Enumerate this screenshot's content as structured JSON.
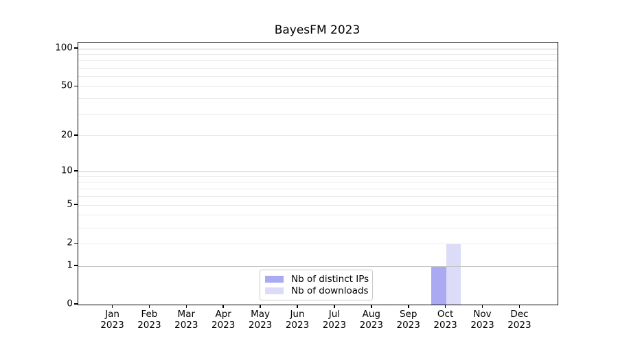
{
  "figure": {
    "title": "BayesFM 2023"
  },
  "chart_data": {
    "type": "bar",
    "title": "BayesFM 2023",
    "categories": [
      "Jan",
      "Feb",
      "Mar",
      "Apr",
      "May",
      "Jun",
      "Jul",
      "Aug",
      "Sep",
      "Oct",
      "Nov",
      "Dec"
    ],
    "year": "2023",
    "series": [
      {
        "name": "Nb of distinct IPs",
        "color": "#aaaaf2",
        "values": [
          0,
          0,
          0,
          0,
          0,
          0,
          0,
          0,
          0,
          1,
          0,
          0
        ]
      },
      {
        "name": "Nb of downloads",
        "color": "#dcdcf8",
        "values": [
          0,
          0,
          0,
          0,
          0,
          0,
          0,
          0,
          0,
          2,
          0,
          0
        ]
      }
    ],
    "xlabel": "",
    "ylabel": "",
    "yscale": "log1p",
    "ylim": [
      0,
      112
    ],
    "y_ticks": [
      0,
      1,
      2,
      5,
      10,
      20,
      50,
      100
    ],
    "grid": true,
    "grid_values": [
      1,
      2,
      3,
      4,
      5,
      6,
      7,
      8,
      9,
      10,
      20,
      30,
      40,
      50,
      60,
      70,
      80,
      90,
      100
    ],
    "grid_major_values": [
      1,
      10,
      100
    ],
    "legend_position": "lower center"
  },
  "colors": {
    "grid_major": "#c6c6c6",
    "grid_minor": "#ebebeb",
    "spine": "#000000",
    "text": "#000000",
    "background": "#ffffff",
    "legend_border": "#c9c9c9"
  }
}
